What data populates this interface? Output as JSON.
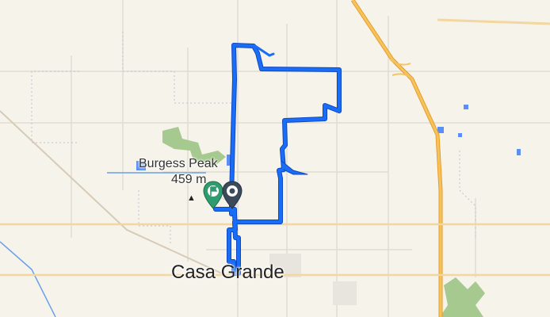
{
  "map": {
    "labels": {
      "peak_name": "Burgess Peak",
      "peak_elevation": "459 m",
      "city": "Casa Grande"
    },
    "icons": {
      "peak": "mountain-peak-icon",
      "start": "flag-marker-icon",
      "end": "destination-pin-icon"
    },
    "colors": {
      "route": "#1a6ef5",
      "route_outline": "#0d47c4",
      "start_marker": "#2e9c6e",
      "end_marker": "#3c4a5c",
      "background": "#f6f3ea",
      "highway": "#f2b33d",
      "water": "#5b8ff7",
      "park": "#a5c98e"
    }
  }
}
